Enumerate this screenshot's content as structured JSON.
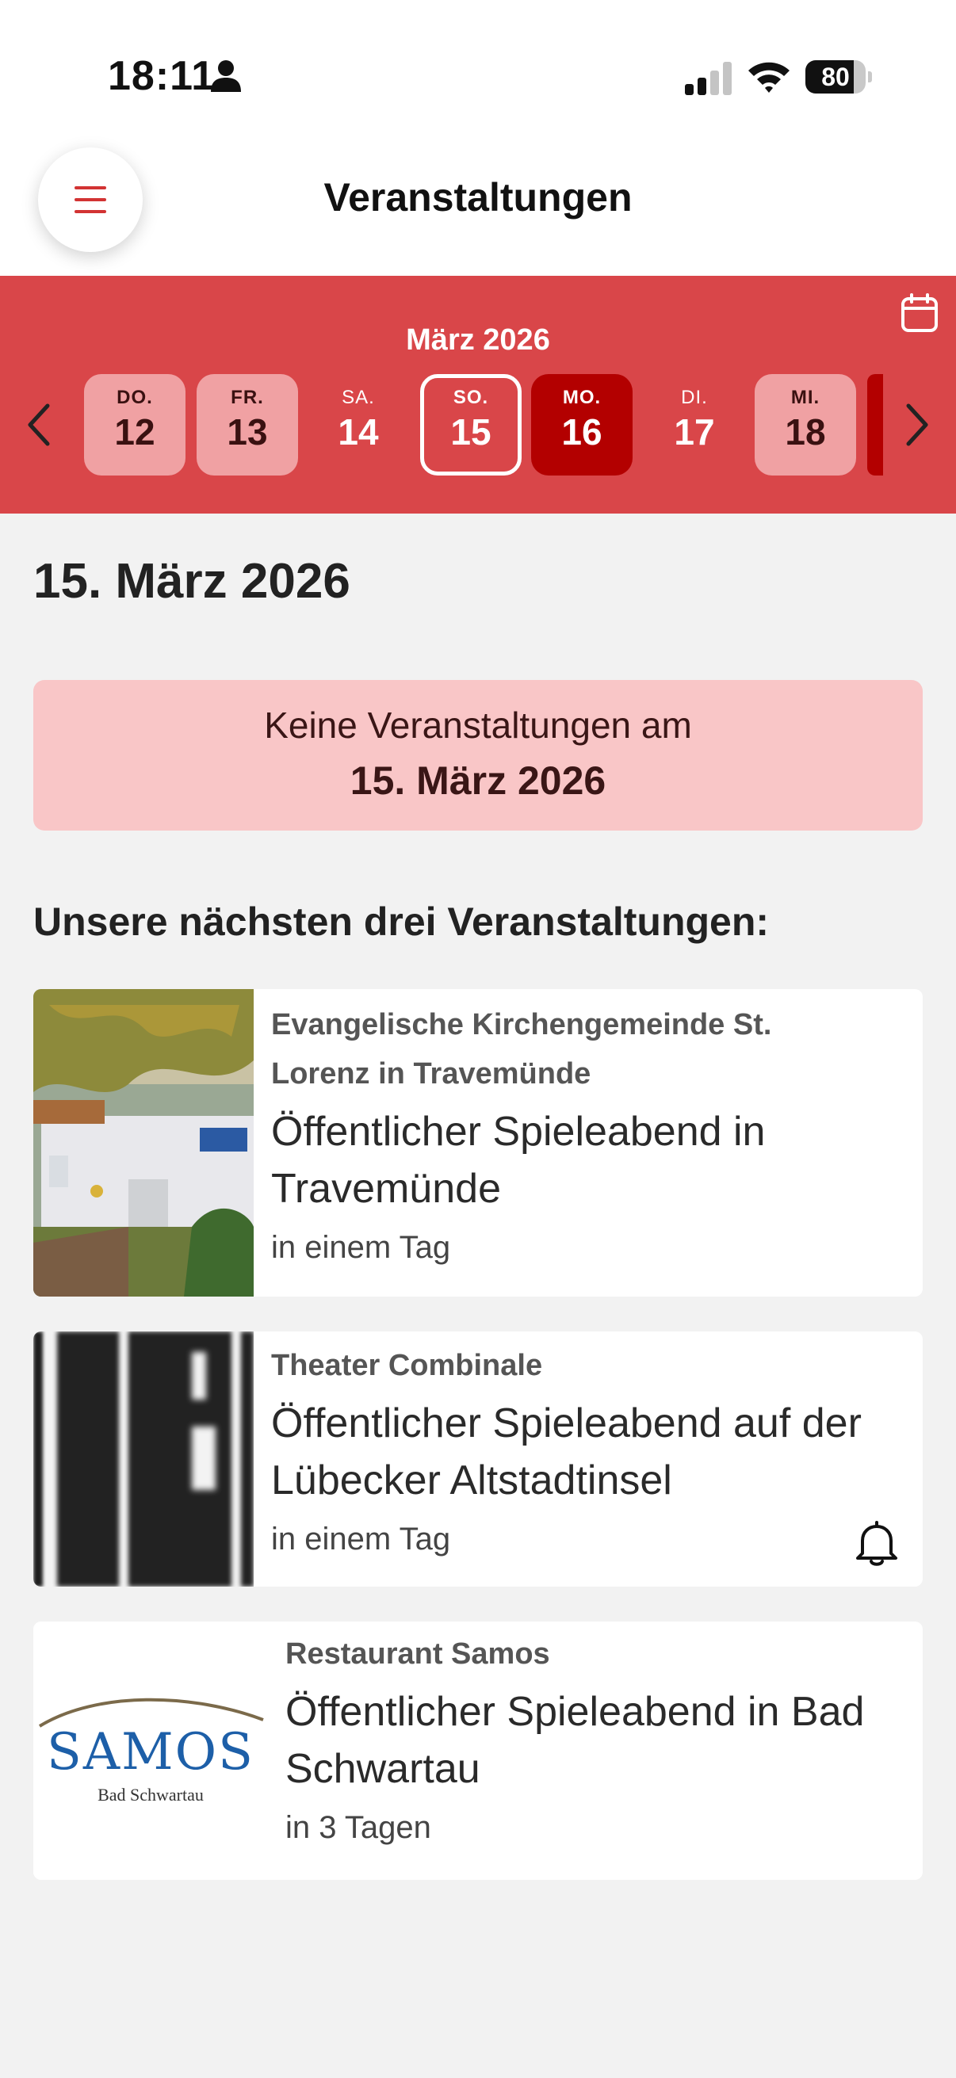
{
  "status_bar": {
    "time": "18:11",
    "battery": "80",
    "battery_level": 0.8,
    "icons": [
      "person-icon",
      "signal-icon",
      "wifi-icon",
      "battery-icon"
    ]
  },
  "header": {
    "title": "Veranstaltungen",
    "menu_icon": "hamburger-menu-icon"
  },
  "date_bar": {
    "month": "März 2026",
    "days": [
      {
        "weekday": "DO.",
        "day": "12",
        "state": "has-events"
      },
      {
        "weekday": "FR.",
        "day": "13",
        "state": "has-events"
      },
      {
        "weekday": "SA.",
        "day": "14",
        "state": "plain"
      },
      {
        "weekday": "SO.",
        "day": "15",
        "state": "selected-outline"
      },
      {
        "weekday": "MO.",
        "day": "16",
        "state": "today"
      },
      {
        "weekday": "DI.",
        "day": "17",
        "state": "plain"
      },
      {
        "weekday": "MI.",
        "day": "18",
        "state": "has-events"
      }
    ],
    "icons": [
      "calendar-icon",
      "chevron-left-icon",
      "chevron-right-icon"
    ]
  },
  "content": {
    "date_heading": "15. März 2026",
    "notice_line1": "Keine Veranstaltungen am",
    "notice_line2": "15. März 2026",
    "section_title": "Unsere nächsten drei Veranstaltungen:"
  },
  "events": [
    {
      "organizer": "Evangelische Kirchengemeinde St. Lorenz in Travemünde",
      "organizer_line1": "Evangelische Kirchengemeinde St.",
      "organizer_line2": "Lorenz in Travemünde",
      "title_line1": "Öffentlicher Spieleabend in",
      "title_line2": "Travemünde",
      "time": "in einem Tag",
      "image": "church-building-photo"
    },
    {
      "organizer": "Theater Combinale",
      "title_line1": "Öffentlicher Spieleabend auf der",
      "title_line2": "Lübecker Altstadtinsel",
      "time": "in einem Tag",
      "image": "theater-combinale-logo",
      "logo_text": "BI",
      "bell_icon": "bell-icon"
    },
    {
      "organizer": "Restaurant Samos",
      "title_line1": "Öffentlicher Spieleabend in Bad",
      "title_line2": "Schwartau",
      "time": "in 3 Tagen",
      "image": "samos-logo",
      "logo_text": "SAMOS",
      "logo_subtext": "Bad Schwartau"
    }
  ],
  "colors": {
    "accent": "#d94649",
    "day_light": "#f0a1a3",
    "day_today": "#b30000",
    "notice_bg": "#f9c6c7",
    "background": "#f2f2f2"
  }
}
